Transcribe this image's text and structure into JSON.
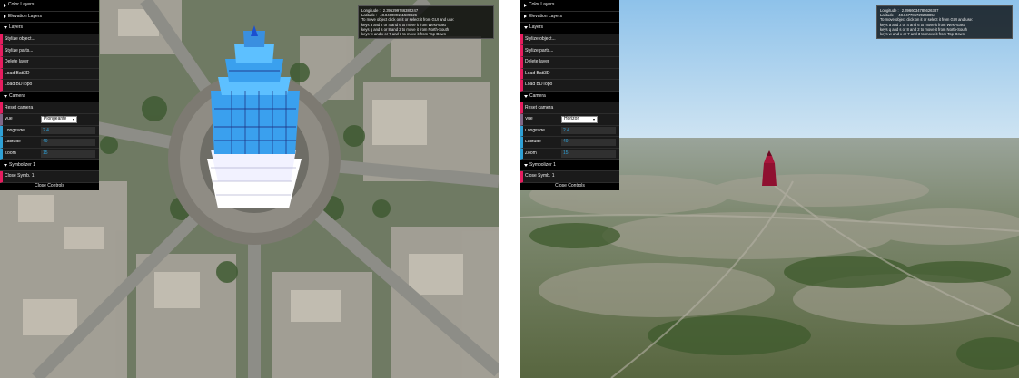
{
  "panels": [
    {
      "gui": {
        "folders": {
          "color_layers": "Color Layers",
          "elevation_layers": "Elevation Layers",
          "layers": "Layers",
          "camera": "Camera",
          "symbolizer": "Symbolizer 1"
        },
        "layers_items": [
          "Stylize object...",
          "Stylize parts...",
          "Delete layer",
          "Load Bati3D",
          "Load BDTopo"
        ],
        "camera": {
          "reset_label": "Reset camera",
          "vue_label": "Vue",
          "vue_value": "Plongeante",
          "longitude_label": "Longitude",
          "longitude_value": "2.4",
          "latitude_label": "Latitude",
          "latitude_value": "49",
          "zoom_label": "Zoom",
          "zoom_value": "15"
        },
        "close_symb": "Close Symb. 1",
        "close_controls": "Close Controls"
      },
      "info": {
        "longitude_label": "Longitude :",
        "longitude_value": "2.395299746385247",
        "latitude_label": "Latitude :",
        "latitude_value": "48.846089151589626",
        "lines": [
          "To move object click on it or select it from GUI and use:",
          "keys a and z or 4 and 6 to move it from West-East",
          "keys q and s or 8 and 2 to move it from North-South",
          "keys w and x or 7 and 3 to move it from Top-Down"
        ]
      }
    },
    {
      "gui": {
        "folders": {
          "color_layers": "Color Layers",
          "elevation_layers": "Elevation Layers",
          "layers": "Layers",
          "camera": "Camera",
          "symbolizer": "Symbolizer 1"
        },
        "layers_items": [
          "Stylize object...",
          "Stylize parts...",
          "Delete layer",
          "Load Bati3D",
          "Load BDTopo"
        ],
        "camera": {
          "reset_label": "Reset camera",
          "vue_label": "Vue",
          "vue_value": "Horizon",
          "longitude_label": "Longitude",
          "longitude_value": "2.4",
          "latitude_label": "Latitude",
          "latitude_value": "49",
          "zoom_label": "Zoom",
          "zoom_value": "15"
        },
        "close_symb": "Close Symb. 1",
        "close_controls": "Close Controls"
      },
      "info": {
        "longitude_label": "Longitude :",
        "longitude_value": "2.3966034785626387",
        "latitude_label": "Latitude :",
        "latitude_value": "48.847785729268854",
        "lines": [
          "To move object click on it or select it from GUI and use:",
          "keys a and z or 4 and 6 to move it from West-East",
          "keys q and s or 8 and 2 to move it from North-South",
          "keys w and x or 7 and 3 to move it from Top-Down"
        ]
      }
    }
  ],
  "colors": {
    "gui_background": "#1a1a1a",
    "function_accent": "#e61d5f",
    "number_accent": "#2fa1d6",
    "option_accent": "#806787",
    "tower_left": "#3aa0ee",
    "tower_right": "#8f1030",
    "sky": "#9fc7e6"
  }
}
